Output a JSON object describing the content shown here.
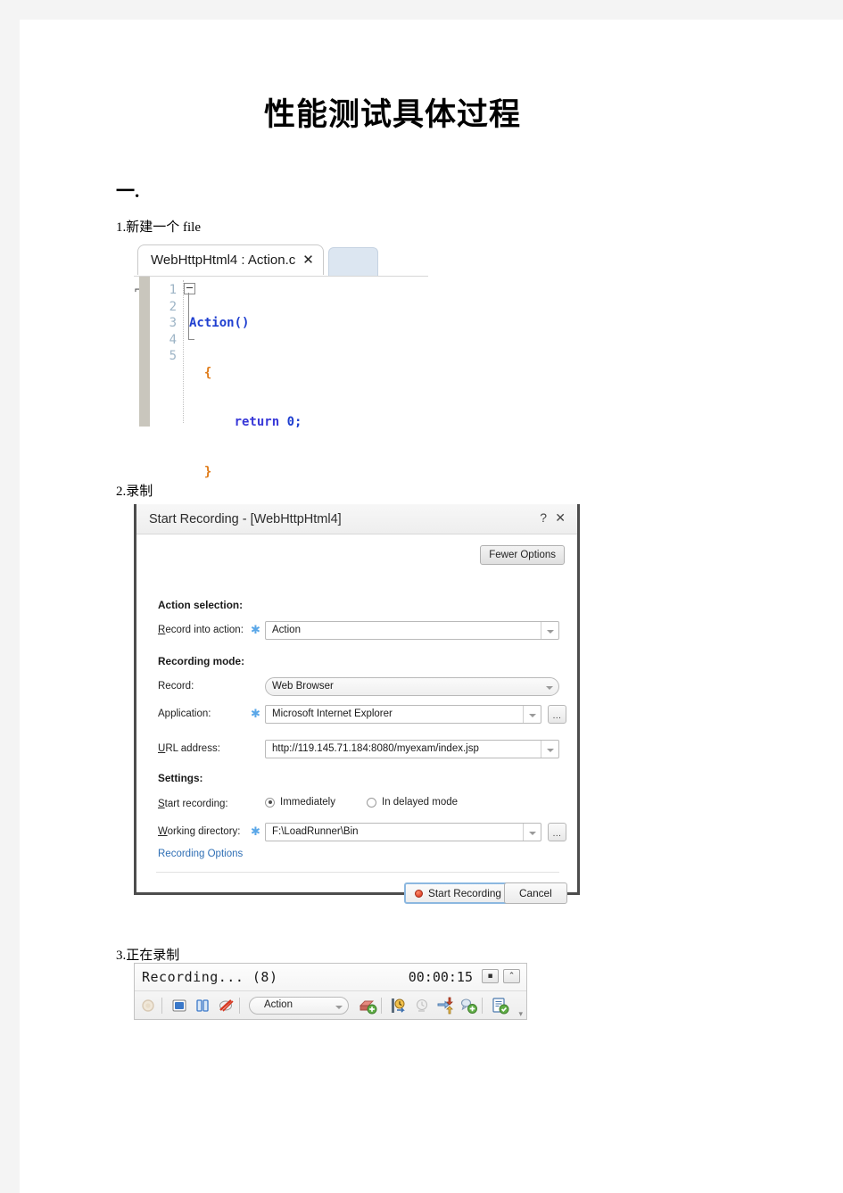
{
  "document": {
    "title": "性能测试具体过程",
    "section_heading": "一.",
    "steps": {
      "step1": "1.新建一个 file",
      "step2": "2.录制",
      "step3": "3.正在录制"
    }
  },
  "editor": {
    "tab_label": "WebHttpHtml4 : Action.c",
    "tab_close": "✕",
    "line_numbers": [
      "1",
      "2",
      "3",
      "4",
      "5"
    ],
    "code": {
      "fn": "Action()",
      "open_brace": "{",
      "return_kw": "return",
      "return_val": "0;",
      "close_brace": "}"
    },
    "bookmark_glyph": "⌐"
  },
  "dialog": {
    "title": "Start Recording - [WebHttpHtml4]",
    "help_glyph": "?",
    "close_glyph": "✕",
    "fewer_options_label": "Fewer Options",
    "groups": {
      "action_selection": "Action selection:",
      "recording_mode": "Recording mode:",
      "settings": "Settings:"
    },
    "fields": {
      "record_into_action_label": "Record into action:",
      "record_into_action_value": "Action",
      "record_label": "Record:",
      "record_value": "Web Browser",
      "application_label": "Application:",
      "application_value": "Microsoft Internet Explorer",
      "url_label": "URL address:",
      "url_value": "http://119.145.71.184:8080/myexam/index.jsp",
      "start_recording_label": "Start recording:",
      "radio_immediately": "Immediately",
      "radio_delayed": "In delayed mode",
      "working_dir_label": "Working directory:",
      "working_dir_value": "F:\\LoadRunner\\Bin"
    },
    "required_star": "✱",
    "ellipsis_label": "...",
    "recording_options_link": "Recording Options",
    "buttons": {
      "start_recording": "Start Recording",
      "cancel": "Cancel"
    }
  },
  "toolbar": {
    "status": "Recording... (8)",
    "timer": "00:00:15",
    "pin_glyph": "▪",
    "collapse_glyph": "⌃",
    "action_value": "Action",
    "overflow_glyph": "▾",
    "icons": [
      "record-icon",
      "stop-icon",
      "pause-icon",
      "no-record-icon",
      "insert-transaction-icon",
      "insert-rendezvous-icon",
      "insert-timer-icon",
      "insert-step-icon",
      "insert-comment-icon",
      "insert-text-check-icon"
    ]
  },
  "colors": {
    "page_background": "#f4f4f4",
    "paper": "#ffffff",
    "link": "#2f6fb5",
    "required_star": "#5aa7e8",
    "primary_border": "#8cb8e0",
    "record_red": "#d32a12",
    "code_keyword": "#3838d8",
    "code_function": "#1f3fd0",
    "code_brace": "#e07b18",
    "gutter_number": "#9db4c6"
  }
}
